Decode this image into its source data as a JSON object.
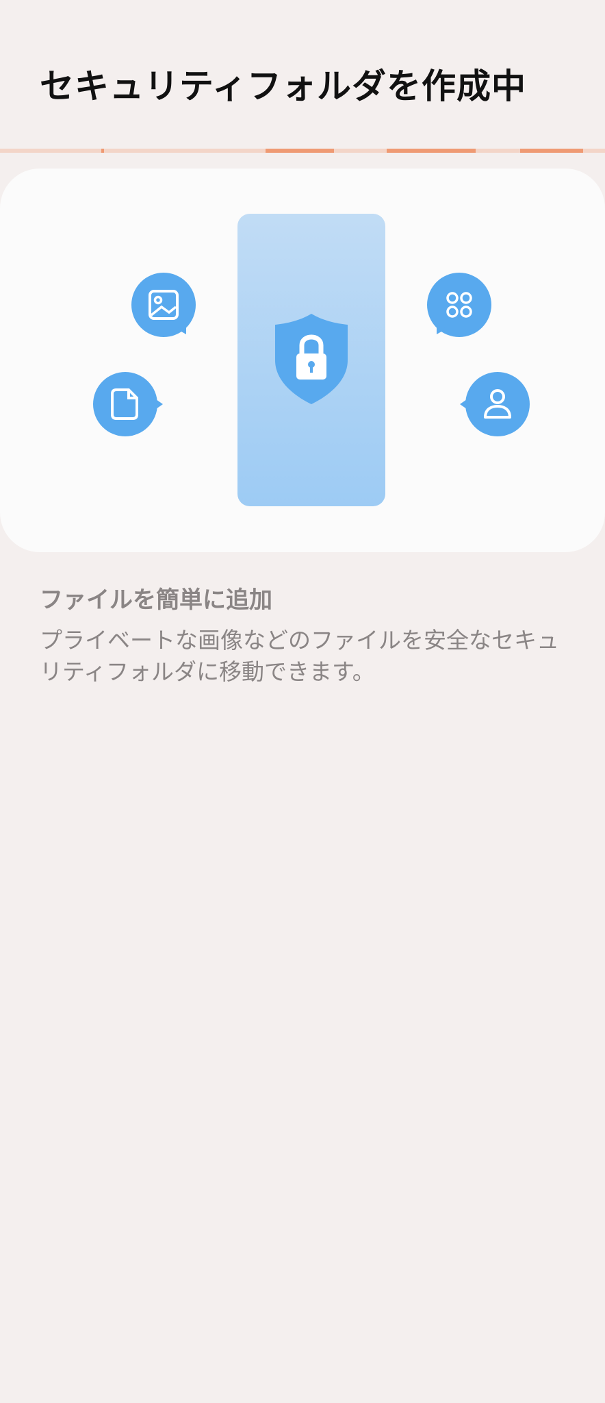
{
  "header": {
    "title": "セキュリティフォルダを作成中"
  },
  "progress": {
    "track_color": "#f3d5c8",
    "active_color": "#ef9a73"
  },
  "illustration": {
    "accent_color": "#58a9ee",
    "icons": [
      "image-icon",
      "file-icon",
      "apps-icon",
      "person-icon",
      "shield-lock-icon"
    ]
  },
  "content": {
    "heading": "ファイルを簡単に追加",
    "description": "プライベートな画像などのファイルを安全なセキュリティフォルダに移動できます。"
  }
}
